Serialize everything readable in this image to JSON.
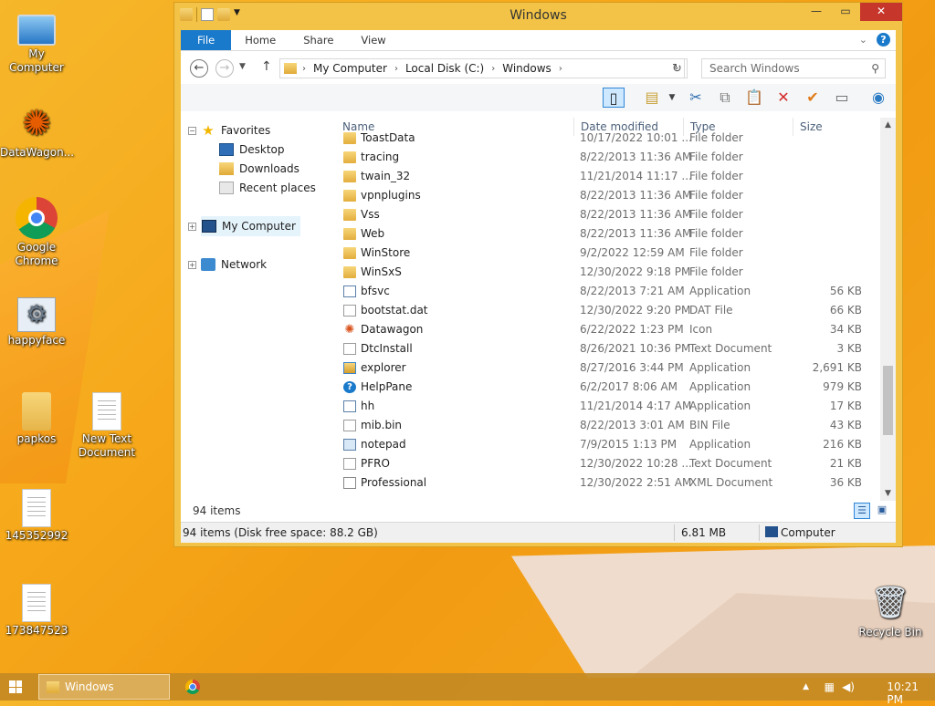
{
  "desktop": {
    "icons": [
      {
        "label": "My Computer"
      },
      {
        "label": "DataWagon..."
      },
      {
        "label": "Google Chrome"
      },
      {
        "label": "happyface"
      },
      {
        "label": "papkos"
      },
      {
        "label": "New Text Document"
      },
      {
        "label": "145352992"
      },
      {
        "label": "173847523"
      },
      {
        "label": "Recycle Bin"
      }
    ]
  },
  "window": {
    "title": "Windows",
    "ribbon_tabs": [
      "File",
      "Home",
      "Share",
      "View"
    ],
    "address": {
      "crumbs": [
        "My Computer",
        "Local Disk (C:)",
        "Windows"
      ]
    },
    "search_placeholder": "Search Windows",
    "nav": {
      "favorites": "Favorites",
      "desktop": "Desktop",
      "downloads": "Downloads",
      "recent": "Recent places",
      "computer": "My Computer",
      "network": "Network"
    },
    "columns": {
      "name": "Name",
      "date": "Date modified",
      "type": "Type",
      "size": "Size"
    },
    "files": [
      {
        "name": "ToastData",
        "date": "10/17/2022 10:01 ...",
        "type": "File folder",
        "size": "",
        "icon": "folder"
      },
      {
        "name": "tracing",
        "date": "8/22/2013 11:36 AM",
        "type": "File folder",
        "size": "",
        "icon": "folder"
      },
      {
        "name": "twain_32",
        "date": "11/21/2014 11:17 ...",
        "type": "File folder",
        "size": "",
        "icon": "folder"
      },
      {
        "name": "vpnplugins",
        "date": "8/22/2013 11:36 AM",
        "type": "File folder",
        "size": "",
        "icon": "folder"
      },
      {
        "name": "Vss",
        "date": "8/22/2013 11:36 AM",
        "type": "File folder",
        "size": "",
        "icon": "folder"
      },
      {
        "name": "Web",
        "date": "8/22/2013 11:36 AM",
        "type": "File folder",
        "size": "",
        "icon": "folder"
      },
      {
        "name": "WinStore",
        "date": "9/2/2022 12:59 AM",
        "type": "File folder",
        "size": "",
        "icon": "folder"
      },
      {
        "name": "WinSxS",
        "date": "12/30/2022 9:18 PM",
        "type": "File folder",
        "size": "",
        "icon": "folder"
      },
      {
        "name": "bfsvc",
        "date": "8/22/2013 7:21 AM",
        "type": "Application",
        "size": "56 KB",
        "icon": "app"
      },
      {
        "name": "bootstat.dat",
        "date": "12/30/2022 9:20 PM",
        "type": "DAT File",
        "size": "66 KB",
        "icon": "file"
      },
      {
        "name": "Datawagon",
        "date": "6/22/2022 1:23 PM",
        "type": "Icon",
        "size": "34 KB",
        "icon": "dw"
      },
      {
        "name": "DtcInstall",
        "date": "8/26/2021 10:36 PM",
        "type": "Text Document",
        "size": "3 KB",
        "icon": "file"
      },
      {
        "name": "explorer",
        "date": "8/27/2016 3:44 PM",
        "type": "Application",
        "size": "2,691 KB",
        "icon": "explorer"
      },
      {
        "name": "HelpPane",
        "date": "6/2/2017 8:06 AM",
        "type": "Application",
        "size": "979 KB",
        "icon": "help"
      },
      {
        "name": "hh",
        "date": "11/21/2014 4:17 AM",
        "type": "Application",
        "size": "17 KB",
        "icon": "app"
      },
      {
        "name": "mib.bin",
        "date": "8/22/2013 3:01 AM",
        "type": "BIN File",
        "size": "43 KB",
        "icon": "file"
      },
      {
        "name": "notepad",
        "date": "7/9/2015 1:13 PM",
        "type": "Application",
        "size": "216 KB",
        "icon": "note"
      },
      {
        "name": "PFRO",
        "date": "12/30/2022 10:28 ...",
        "type": "Text Document",
        "size": "21 KB",
        "icon": "file"
      },
      {
        "name": "Professional",
        "date": "12/30/2022 2:51 AM",
        "type": "XML Document",
        "size": "36 KB",
        "icon": "xml"
      }
    ],
    "item_count": "94 items",
    "status": {
      "left": "94 items (Disk free space: 88.2 GB)",
      "size": "6.81 MB",
      "location": "Computer"
    }
  },
  "taskbar": {
    "task_label": "Windows",
    "clock": "10:21 PM"
  }
}
